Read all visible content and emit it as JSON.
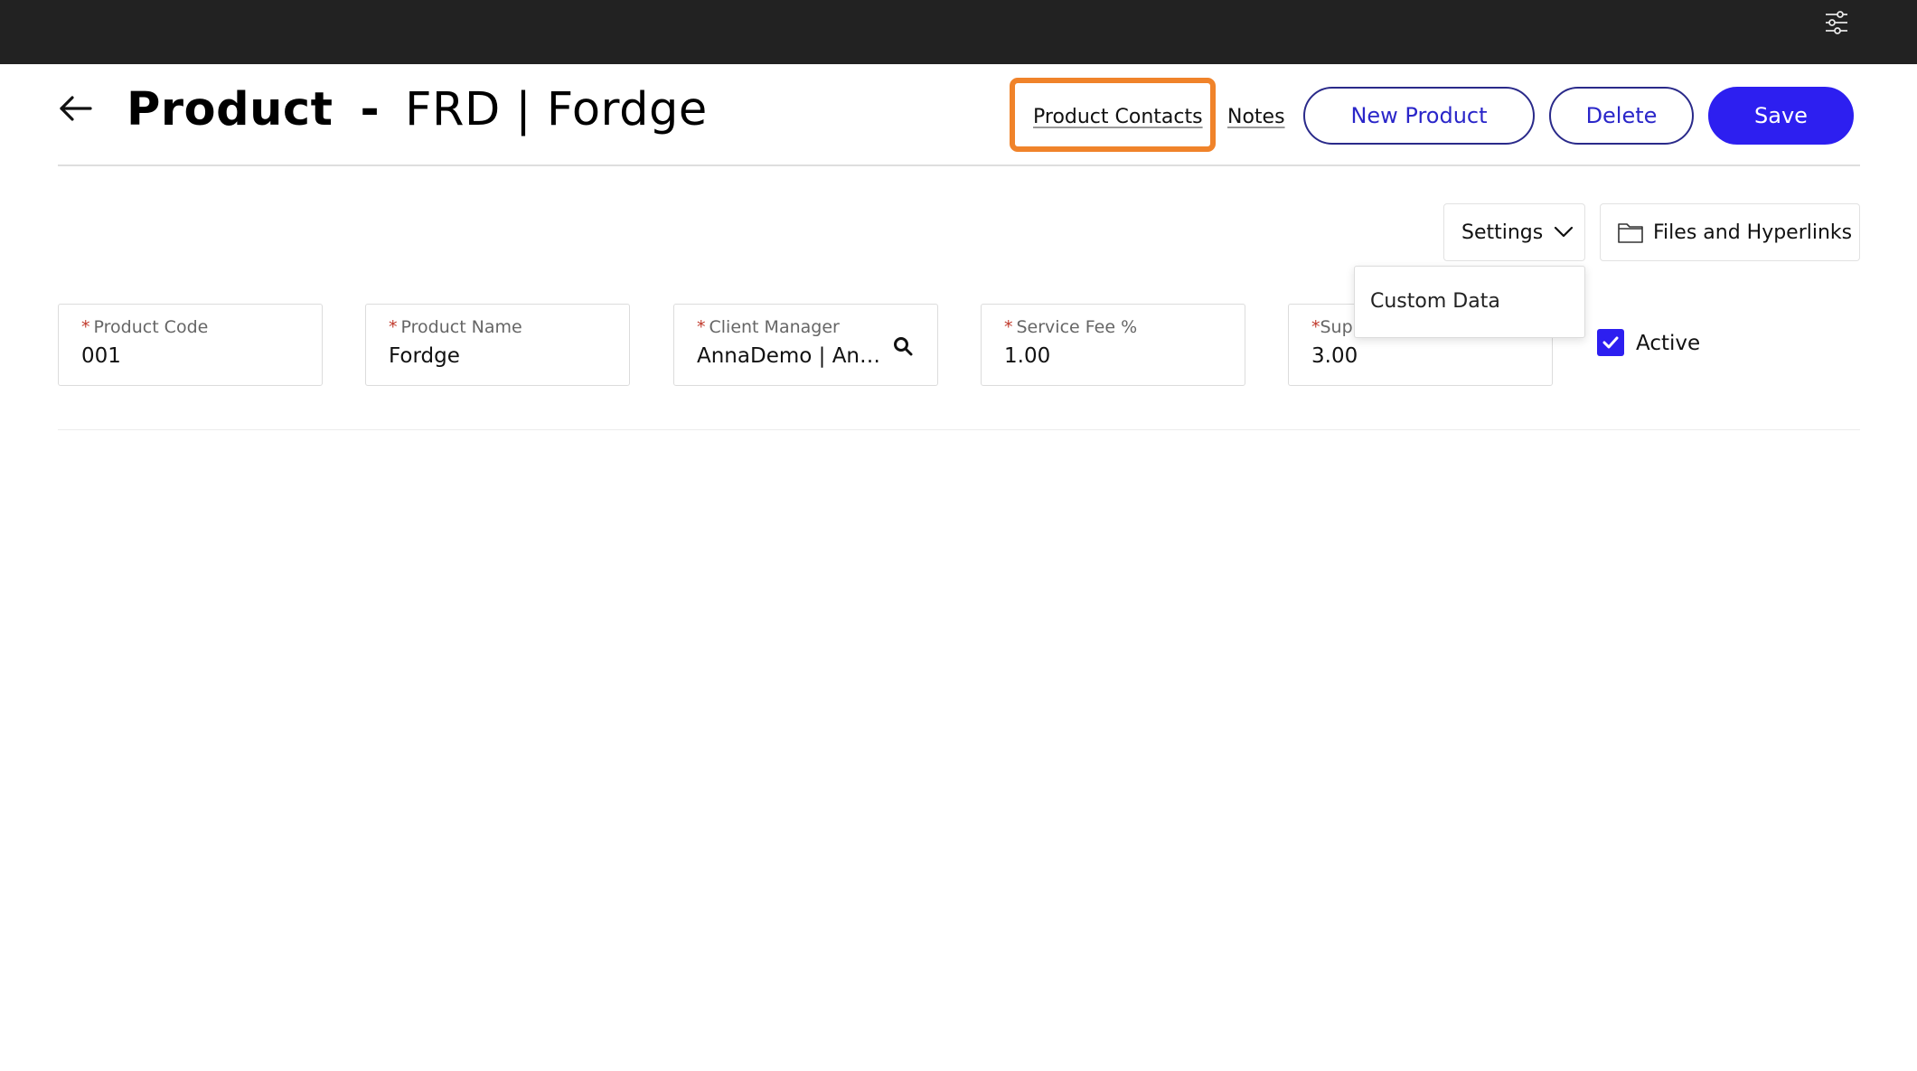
{
  "header": {
    "entity": "Product",
    "separator": "-",
    "record": "FRD | Fordge"
  },
  "actions": {
    "product_contacts": "Product Contacts",
    "notes": "Notes",
    "new_product": "New Product",
    "delete": "Delete",
    "save": "Save"
  },
  "toolbar": {
    "settings": "Settings",
    "files": "Files and Hyperlinks"
  },
  "settings_menu": {
    "items": [
      "Custom Data"
    ]
  },
  "fields": [
    {
      "label": "Product Code",
      "value": "001"
    },
    {
      "label": "Product Name",
      "value": "Fordge"
    },
    {
      "label": "Client Manager",
      "value": "AnnaDemo | Ann..."
    },
    {
      "label": "Service Fee %",
      "value": "1.00"
    },
    {
      "label": "Sup",
      "value": "3.00"
    }
  ],
  "active": {
    "label": "Active",
    "checked": true
  },
  "colors": {
    "primary": "#2d1ff0",
    "highlight": "#f0832a",
    "topbar": "#222222"
  },
  "icons": [
    "filter-sliders-icon",
    "back-arrow-icon",
    "chevron-down-icon",
    "folder-icon",
    "search-icon",
    "checkmark-icon"
  ]
}
